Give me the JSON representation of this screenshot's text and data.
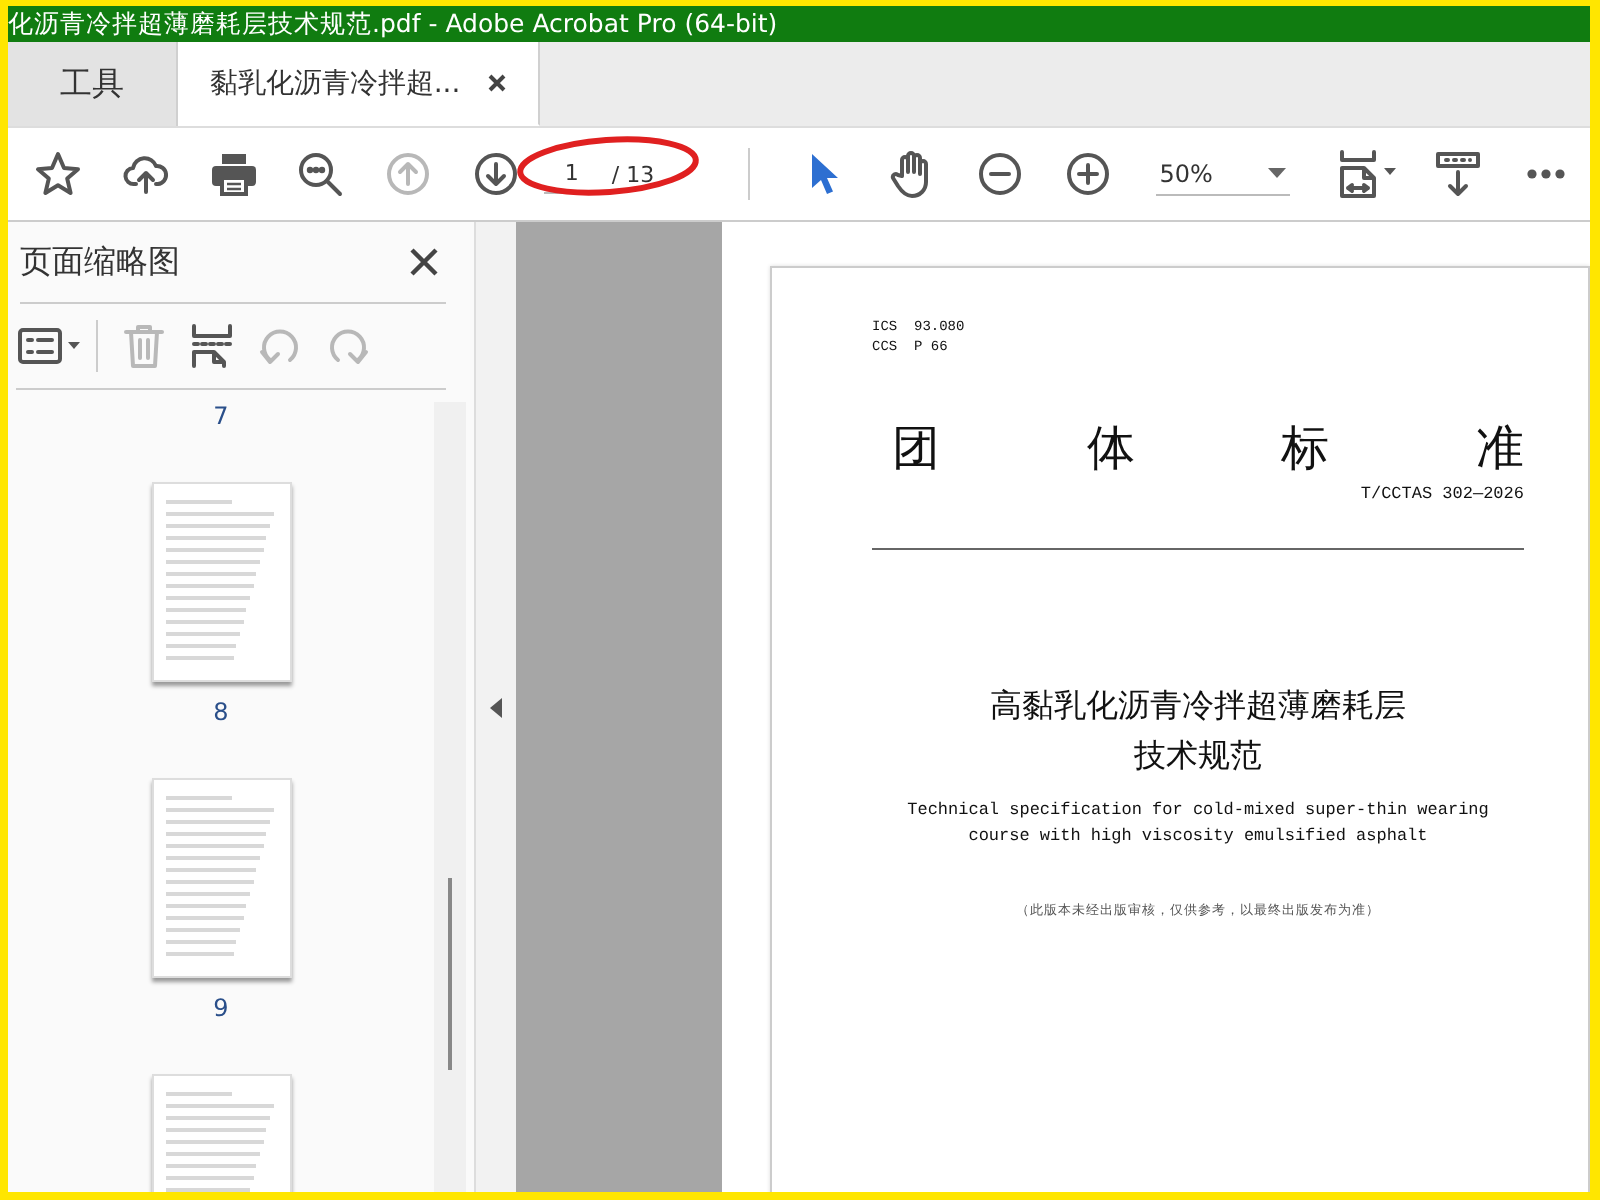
{
  "window": {
    "title": "化沥青冷拌超薄磨耗层技术规范.pdf - Adobe Acrobat Pro (64-bit)"
  },
  "tabs": [
    {
      "label": "工具",
      "selected": false,
      "closable": false
    },
    {
      "label": "黏乳化沥青冷拌超...",
      "selected": true,
      "closable": true
    }
  ],
  "toolbar": {
    "items": [
      {
        "kind": "star",
        "disabled": false
      },
      {
        "kind": "upload",
        "disabled": false
      },
      {
        "kind": "print",
        "disabled": false
      },
      {
        "kind": "zoom-search",
        "disabled": false
      },
      {
        "kind": "prev-page",
        "disabled": true
      },
      {
        "kind": "next-page",
        "disabled": false
      },
      {
        "kind": "page-field",
        "value": "1",
        "count": "/ 13"
      },
      {
        "kind": "separator"
      },
      {
        "kind": "select",
        "selected": true
      },
      {
        "kind": "hand",
        "selected": false
      },
      {
        "kind": "zoom-out",
        "disabled": false
      },
      {
        "kind": "zoom-in",
        "disabled": false
      },
      {
        "kind": "zoom-field",
        "value": "50%"
      },
      {
        "kind": "fit",
        "disabled": false
      },
      {
        "kind": "read-mode",
        "disabled": false
      },
      {
        "kind": "more",
        "disabled": false
      }
    ],
    "annotation": {
      "kind": "ellipse",
      "color": "#e02020"
    }
  },
  "sidebar": {
    "title": "页面缩略图",
    "tools": [
      {
        "kind": "options",
        "disabled": false
      },
      {
        "kind": "separator"
      },
      {
        "kind": "delete",
        "disabled": true
      },
      {
        "kind": "insert",
        "disabled": false
      },
      {
        "kind": "rotate-left",
        "disabled": true
      },
      {
        "kind": "rotate-right",
        "disabled": true
      }
    ],
    "items": [
      {
        "kind": "label",
        "label": "7"
      },
      {
        "kind": "page"
      },
      {
        "kind": "label",
        "label": "8"
      },
      {
        "kind": "page"
      },
      {
        "kind": "label",
        "label": "9"
      },
      {
        "kind": "page"
      }
    ]
  },
  "document": {
    "classification": [
      "ICS  93.080",
      "CCS  P 66"
    ],
    "heading": "团体标准",
    "code": "T/CCTAS 302—2026",
    "title_lines": [
      "高黏乳化沥青冷拌超薄磨耗层",
      "技术规范"
    ],
    "english_title": "Technical specification for cold-mixed super-thin wearing course with high viscosity emulsified asphalt",
    "note": "（此版本未经出版审核，仅供参考，以最终出版发布为准）"
  }
}
